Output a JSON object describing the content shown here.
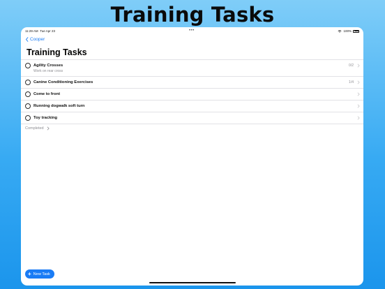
{
  "banner": {
    "title": "Training Tasks"
  },
  "status_bar": {
    "time": "11:29 AM",
    "date": "Tue Apr 23",
    "battery": "100%"
  },
  "nav": {
    "back_label": "Cooper"
  },
  "page": {
    "title": "Training Tasks"
  },
  "tasks": [
    {
      "title": "Agility Crosses",
      "subtitle": "Work on rear cross",
      "count": "0/2"
    },
    {
      "title": "Canine Conditioning Exercises",
      "subtitle": "",
      "count": "1/4"
    },
    {
      "title": "Come to front",
      "subtitle": "",
      "count": ""
    },
    {
      "title": "Running dogwalk soft turn",
      "subtitle": "",
      "count": ""
    },
    {
      "title": "Toy tracking",
      "subtitle": "",
      "count": ""
    }
  ],
  "completed": {
    "label": "Completed"
  },
  "new_task": {
    "label": "New Task"
  },
  "colors": {
    "accent": "#1a7cf5",
    "background_top": "#7fcdf8",
    "background_bottom": "#1b95ec"
  },
  "icons": [
    "chevron-left-icon",
    "circle-icon",
    "chevron-right-icon",
    "plus-icon",
    "wifi-icon",
    "battery-icon"
  ]
}
